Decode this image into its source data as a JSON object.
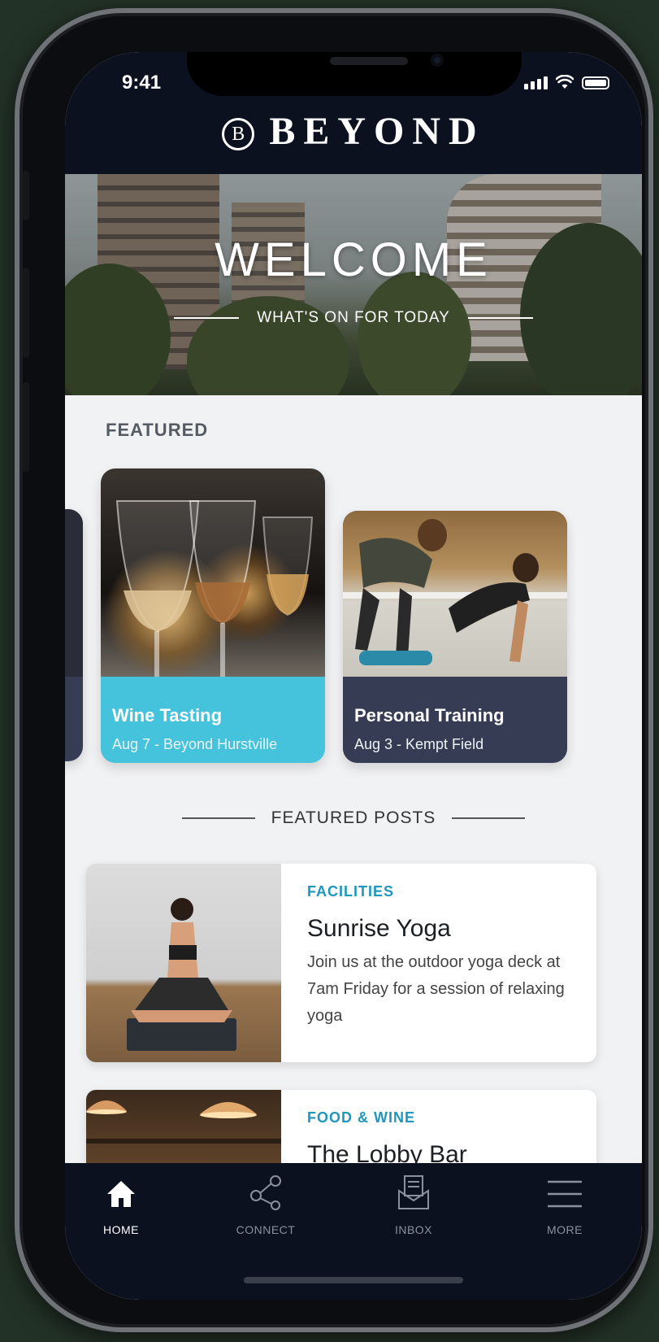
{
  "status_bar": {
    "time": "9:41"
  },
  "header": {
    "logo_mark": "B",
    "brand": "BEYOND"
  },
  "hero": {
    "title": "WELCOME",
    "tagline": "WHAT'S ON FOR TODAY"
  },
  "featured": {
    "label": "FEATURED",
    "cards": [
      {
        "title": "Wine Tasting",
        "subtitle": "Aug 7 - Beyond Hurstville",
        "color": "#45c3dc"
      },
      {
        "title": "Personal Training",
        "subtitle": "Aug 3 - Kempt Field",
        "color": "#373c55"
      }
    ]
  },
  "featured_posts": {
    "label": "FEATURED POSTS",
    "posts": [
      {
        "category": "FACILITIES",
        "title": "Sunrise Yoga",
        "description": "Join us at the outdoor yoga deck at 7am Friday for a session of relaxing yoga"
      },
      {
        "category": "FOOD & WINE",
        "title": "The Lobby Bar"
      }
    ]
  },
  "tabbar": {
    "items": [
      {
        "label": "HOME",
        "icon": "home-icon",
        "active": true
      },
      {
        "label": "CONNECT",
        "icon": "share-icon",
        "active": false
      },
      {
        "label": "INBOX",
        "icon": "inbox-icon",
        "active": false
      },
      {
        "label": "MORE",
        "icon": "menu-icon",
        "active": false
      }
    ]
  },
  "colors": {
    "navy": "#0c1120",
    "accent_cyan": "#45c3dc",
    "card_dark": "#373c55",
    "category_blue": "#1e96bd"
  }
}
